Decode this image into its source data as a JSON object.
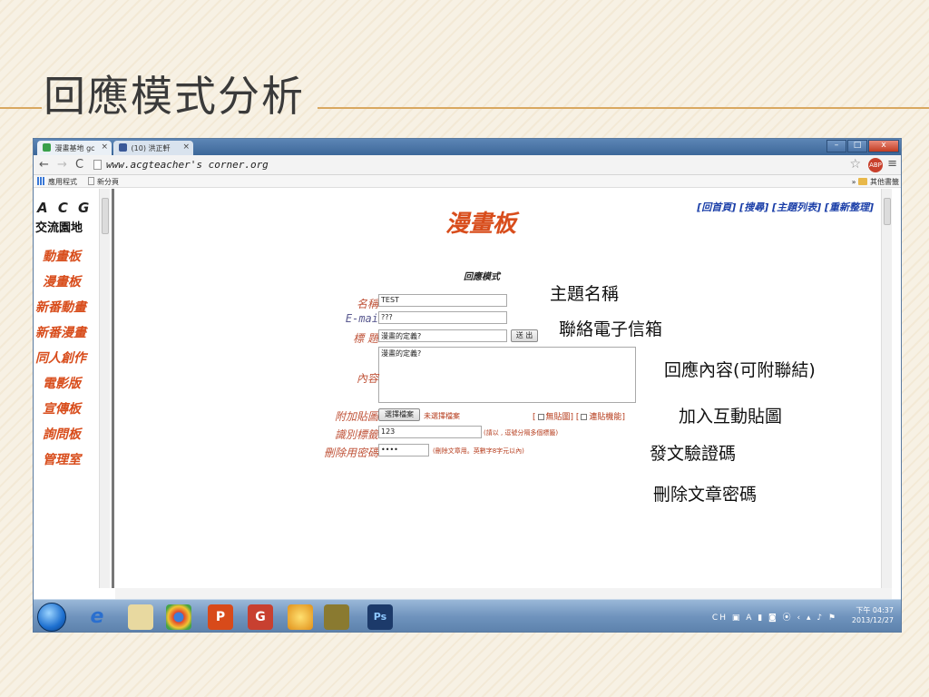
{
  "slide": {
    "title": "回應模式分析"
  },
  "browser": {
    "tabs": [
      {
        "label": "漫畫基地 gc"
      },
      {
        "label": "(10) 洪正軒"
      }
    ],
    "url": "www.acgteacher's corner.org",
    "bookmarks": {
      "apps": "應用程式",
      "newtab": "新分頁",
      "others": "其他書籤"
    }
  },
  "sidebar": {
    "logo_line1": "A C G",
    "logo_line2": "交流園地",
    "links": [
      "動畫板",
      "漫畫板",
      "新番動畫",
      "新番漫畫",
      "同人創作",
      "電影版",
      "宣傳板",
      "詢問板",
      "管理室"
    ]
  },
  "main": {
    "top_links": "[回首頁] [搜尋] [主題列表] [重新整理]",
    "board_title": "漫畫板",
    "mode_title": "回應模式",
    "form": {
      "name_label": "名稱",
      "name_value": "TEST",
      "email_label": "E-mai",
      "email_value": "???",
      "subject_label": "標 題",
      "subject_value": "漫畫的定義?",
      "submit_label": "送 出",
      "content_label": "內容",
      "content_value": "漫畫的定義?",
      "attach_label": "附加貼圖",
      "file_button": "選擇檔案",
      "file_status": "未選擇檔案",
      "no_image_label": "無貼圖",
      "link_label": "連貼機能",
      "tag_label": "識別標籤",
      "tag_value": "123",
      "tag_hint": "(請以 , 逗號分隔多個標籤)",
      "password_label": "刪除用密碼",
      "password_value": "••••",
      "password_hint": "(刪除文章用。英數字8字元以內)"
    }
  },
  "taskbar": {
    "time": "下午 04:37",
    "date": "2013/12/27",
    "lang": "CH"
  },
  "annotations": [
    "主題名稱",
    "聯絡電子信箱",
    "回應內容(可附聯結)",
    "加入互動貼圖",
    "發文驗證碼",
    "刪除文章密碼"
  ]
}
